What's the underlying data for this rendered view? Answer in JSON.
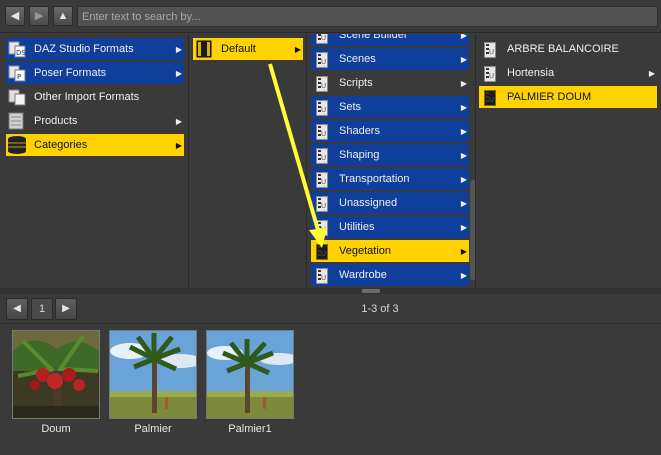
{
  "toolbar": {
    "back_icon": "arrow-left-icon",
    "forward_icon": "arrow-right-icon",
    "up_icon": "arrow-up-icon",
    "search_placeholder": "Enter text to search by..."
  },
  "column1": {
    "items": [
      {
        "label": "DAZ Studio Formats",
        "state": "blue",
        "icon": "daz-format-icon"
      },
      {
        "label": "Poser Formats",
        "state": "blue",
        "icon": "poser-format-icon"
      },
      {
        "label": "Other Import Formats",
        "state": "dark",
        "icon": "import-format-icon"
      },
      {
        "label": "Products",
        "state": "dark",
        "icon": "products-icon"
      },
      {
        "label": "Categories",
        "state": "gold",
        "icon": "categories-icon"
      }
    ]
  },
  "column2": {
    "items": [
      {
        "label": "Default",
        "state": "gold",
        "icon": "category-folder-icon"
      }
    ]
  },
  "column3": {
    "items": [
      {
        "label": "Scene Builder",
        "state": "blue"
      },
      {
        "label": "Scenes",
        "state": "blue"
      },
      {
        "label": "Scripts",
        "state": "dark"
      },
      {
        "label": "Sets",
        "state": "blue"
      },
      {
        "label": "Shaders",
        "state": "blue"
      },
      {
        "label": "Shaping",
        "state": "blue"
      },
      {
        "label": "Transportation",
        "state": "blue"
      },
      {
        "label": "Unassigned",
        "state": "blue"
      },
      {
        "label": "Utilities",
        "state": "blue"
      },
      {
        "label": "Vegetation",
        "state": "gold"
      },
      {
        "label": "Wardrobe",
        "state": "blue"
      }
    ]
  },
  "column4": {
    "items": [
      {
        "label": "ARBRE BALANCOIRE",
        "state": "dark",
        "has_arrow": false
      },
      {
        "label": "Hortensia",
        "state": "dark",
        "has_arrow": true
      },
      {
        "label": "PALMIER DOUM",
        "state": "gold",
        "has_arrow": false
      }
    ]
  },
  "pager": {
    "prev_icon": "arrow-left-icon",
    "next_icon": "arrow-right-icon",
    "page": "1",
    "count": "1-3 of 3"
  },
  "thumbnails": [
    {
      "label": "Doum"
    },
    {
      "label": "Palmier"
    },
    {
      "label": "Palmier1"
    }
  ],
  "colors": {
    "selected": "#ffd200",
    "highlight_blue": "#0f3f9a",
    "annotation_arrow": "#ffff33"
  }
}
